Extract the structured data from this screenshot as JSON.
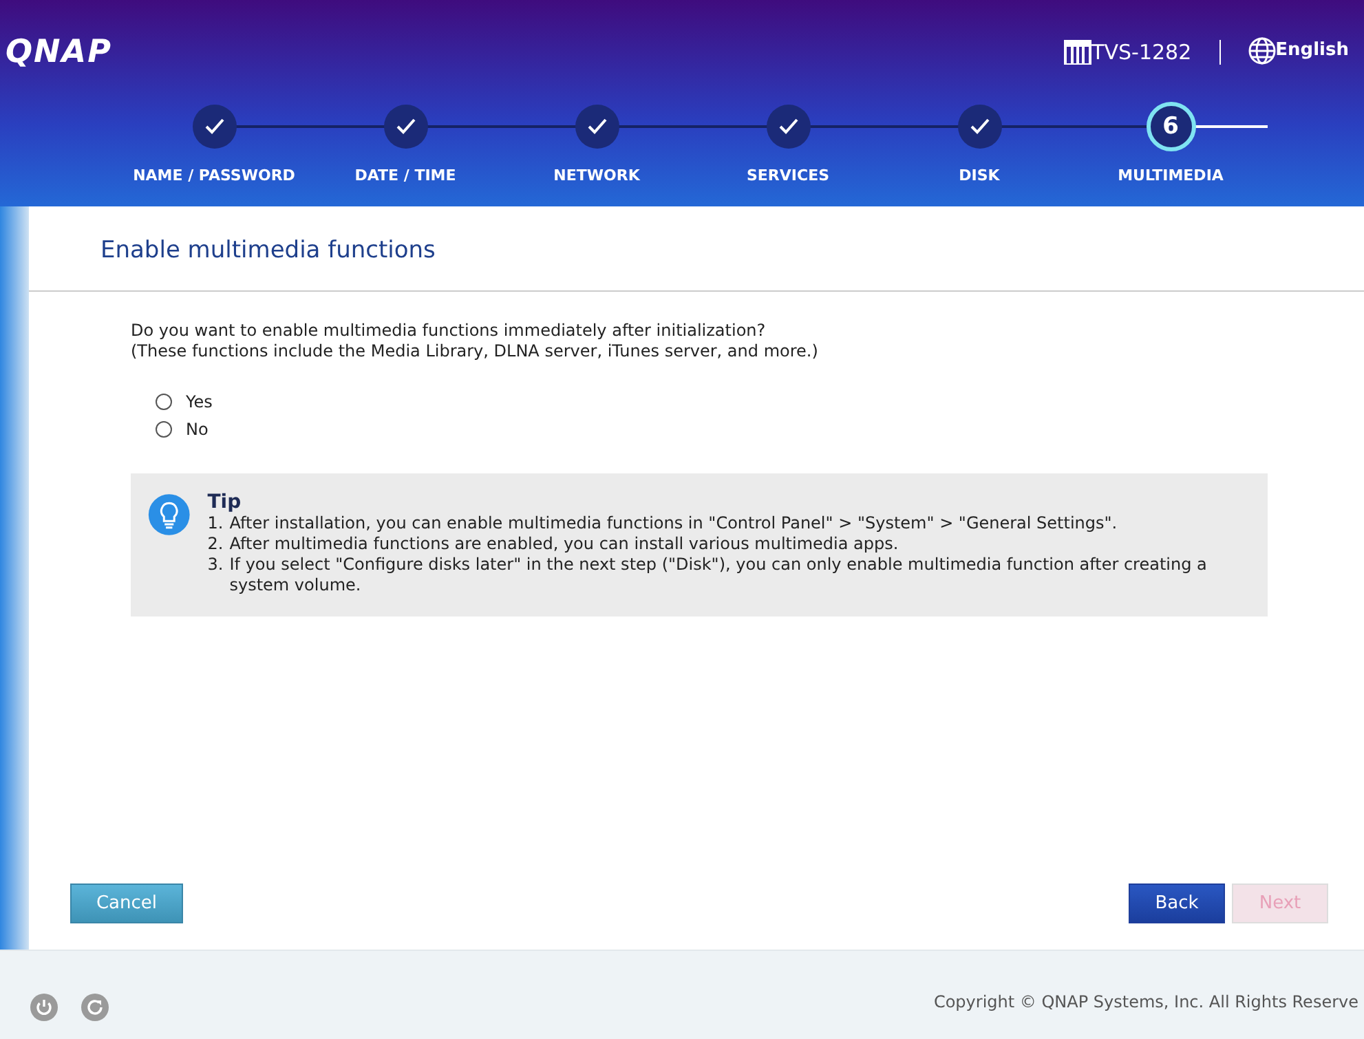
{
  "header": {
    "logo": "QNAP",
    "model": "TVS-1282",
    "language": "English"
  },
  "steps": [
    {
      "label": "NAME / PASSWORD",
      "completed": true,
      "selected": false
    },
    {
      "label": "DATE / TIME",
      "completed": true,
      "selected": false
    },
    {
      "label": "NETWORK",
      "completed": true,
      "selected": false
    },
    {
      "label": "SERVICES",
      "completed": true,
      "selected": false
    },
    {
      "label": "DISK",
      "completed": true,
      "selected": false
    },
    {
      "label": "MULTIMEDIA",
      "completed": false,
      "selected": true,
      "number": "6"
    }
  ],
  "panel": {
    "title": "Enable multimedia functions",
    "question": [
      "Do you want to enable multimedia functions immediately after initialization?",
      "(These functions include the Media Library, DLNA server, iTunes server, and more.)"
    ],
    "options": [
      {
        "label": "Yes",
        "checked": false
      },
      {
        "label": "No",
        "checked": false
      }
    ],
    "tip": {
      "title": "Tip",
      "items": [
        {
          "number": "1.",
          "text": "After installation, you can enable multimedia functions in \"Control Panel\" > \"System\" > \"General Settings\"."
        },
        {
          "number": "2.",
          "text": "After multimedia functions are enabled, you can install various multimedia apps."
        },
        {
          "number": "3.",
          "text": "If you select \"Configure disks later\" in the next step (\"Disk\"), you can only enable multimedia function after creating a system volume."
        }
      ]
    },
    "buttons": [
      {
        "label": "Cancel",
        "kind": "cancel",
        "disabled": false
      },
      {
        "label": "Back",
        "kind": "primary",
        "disabled": false
      },
      {
        "label": "Next",
        "kind": "primary",
        "disabled": true
      }
    ]
  },
  "footer": {
    "copyright": "Copyright © QNAP Systems, Inc. All Rights Reserve"
  }
}
